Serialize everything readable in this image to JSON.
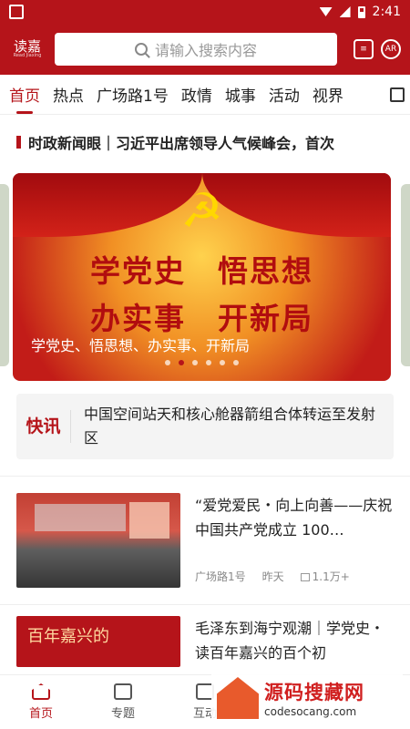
{
  "status": {
    "time": "2:41"
  },
  "appbar": {
    "logo_text": "读嘉",
    "logo_sub": "Read Jiaxing",
    "search_placeholder": "请输入搜索内容",
    "ar_label": "AR"
  },
  "tabs": [
    "首页",
    "热点",
    "广场路1号",
    "政情",
    "城事",
    "活动",
    "视界"
  ],
  "headline": "时政新闻眼｜习近平出席领导人气候峰会，首次",
  "carousel": {
    "big_line1": "学党史　悟思想",
    "big_line2": "办实事　开新局",
    "caption": "学党史、悟思想、办实事、开新局",
    "dots": 6,
    "active_dot": 1
  },
  "flash": {
    "label": "快讯",
    "text": "中国空间站天和核心舱器箭组合体转运至发射区"
  },
  "news": [
    {
      "title": "“爱党爱民・向上向善——庆祝中国共产党成立 100…",
      "source": "广场路1号",
      "time": "昨天",
      "views": "1.1万+"
    },
    {
      "title": "毛泽东到海宁观潮｜学党史・读百年嘉兴的百个初",
      "thumb_text": "百年嘉兴的"
    }
  ],
  "bottom_nav": [
    "首页",
    "专题",
    "互动"
  ],
  "watermark": {
    "line1": "源码搜藏网",
    "line2": "codesocang.com"
  }
}
